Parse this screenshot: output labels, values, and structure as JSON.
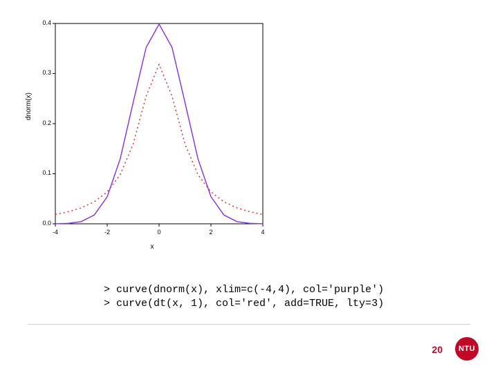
{
  "chart_data": {
    "type": "line",
    "title": "",
    "xlabel": "x",
    "ylabel": "dnorm(x)",
    "xlim": [
      -4,
      4
    ],
    "ylim": [
      0.0,
      0.4
    ],
    "xticks": [
      -4,
      -2,
      0,
      2,
      4
    ],
    "yticks": [
      0.0,
      0.1,
      0.2,
      0.3,
      0.4
    ],
    "series": [
      {
        "name": "dnorm(x)",
        "color": "#8a2be2",
        "lty": "solid",
        "x": [
          -4,
          -3.5,
          -3,
          -2.5,
          -2,
          -1.5,
          -1,
          -0.5,
          0,
          0.5,
          1,
          1.5,
          2,
          2.5,
          3,
          3.5,
          4
        ],
        "y": [
          0.0001338,
          0.0008727,
          0.004432,
          0.01753,
          0.05399,
          0.1295,
          0.242,
          0.3521,
          0.3989,
          0.3521,
          0.242,
          0.1295,
          0.05399,
          0.01753,
          0.004432,
          0.0008727,
          0.0001338
        ]
      },
      {
        "name": "dt(x, 1)",
        "color": "#d22",
        "lty": "dotted",
        "x": [
          -4,
          -3.5,
          -3,
          -2.5,
          -2,
          -1.5,
          -1,
          -0.5,
          0,
          0.5,
          1,
          1.5,
          2,
          2.5,
          3,
          3.5,
          4
        ],
        "y": [
          0.01872,
          0.02402,
          0.03183,
          0.0439,
          0.06366,
          0.09794,
          0.15915,
          0.25465,
          0.31831,
          0.25465,
          0.15915,
          0.09794,
          0.06366,
          0.0439,
          0.03183,
          0.02402,
          0.01872
        ]
      }
    ]
  },
  "code": {
    "line1": "> curve(dnorm(x), xlim=c(-4,4), col='purple')",
    "line2": "> curve(dt(x, 1), col='red', add=TRUE, lty=3)"
  },
  "footer": {
    "page_number": "20",
    "logo_text": "NTU"
  }
}
